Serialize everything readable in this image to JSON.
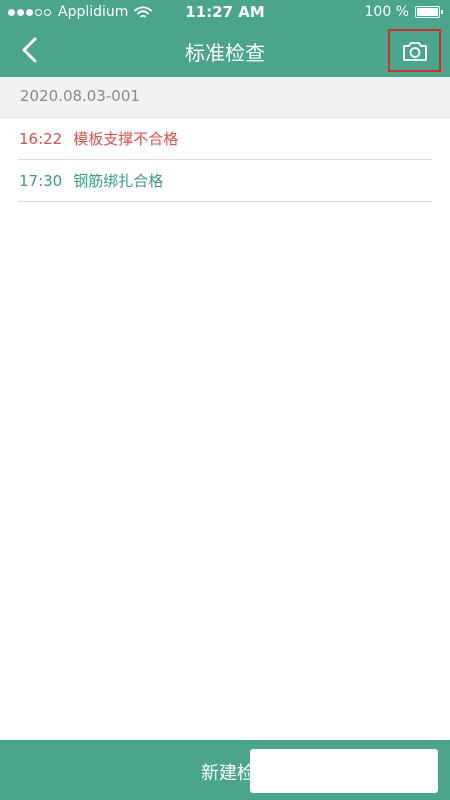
{
  "status_bar": {
    "carrier": "Applidium",
    "time": "11:27 AM",
    "battery": "100 %"
  },
  "header": {
    "title": "标准检查"
  },
  "record": {
    "id": "2020.08.03-001"
  },
  "checks": [
    {
      "time": "16:22",
      "label": "模板支撑不合格",
      "status": "fail"
    },
    {
      "time": "17:30",
      "label": "钢筋绑扎合格",
      "status": "pass"
    }
  ],
  "footer": {
    "button_label": "新建检查"
  },
  "colors": {
    "brand": "#4aa58c",
    "fail": "#d9534f",
    "pass": "#3e9a86",
    "highlight": "#d0302b"
  },
  "icons": {
    "back": "chevron-left-icon",
    "camera": "camera-icon",
    "wifi": "wifi-icon",
    "battery": "battery-icon"
  }
}
